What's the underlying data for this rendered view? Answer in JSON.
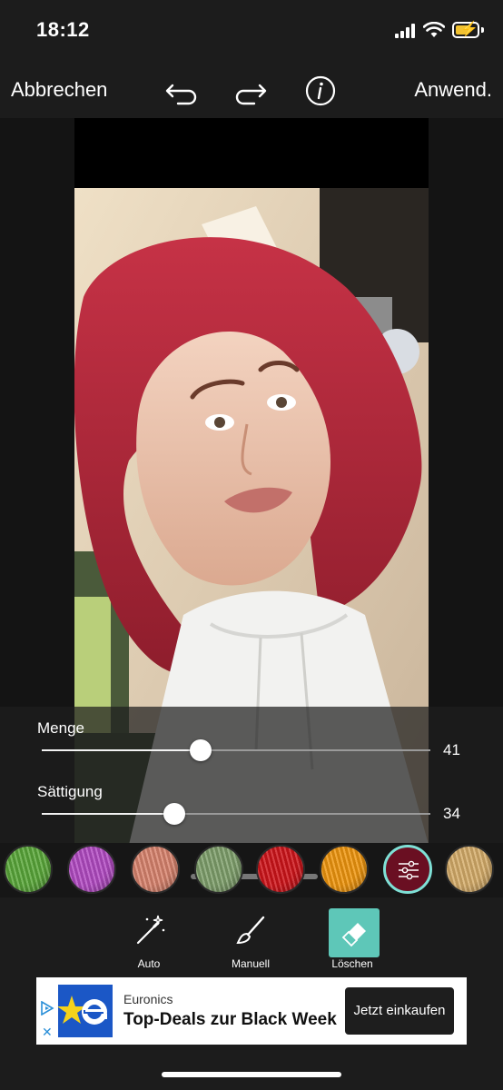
{
  "status_bar": {
    "time": "18:12"
  },
  "toolbar": {
    "cancel_label": "Abbrechen",
    "apply_label": "Anwend.",
    "icons": [
      "undo-icon",
      "redo-icon",
      "info-icon"
    ]
  },
  "sliders": {
    "amount": {
      "label": "Menge",
      "value": "41",
      "level": 0.41
    },
    "saturation": {
      "label": "Sättigung",
      "value": "34",
      "level": 0.34
    }
  },
  "colors": {
    "swatches": [
      {
        "name": "green",
        "color": "#5aa83a"
      },
      {
        "name": "purple",
        "color": "#b34bc4"
      },
      {
        "name": "peach",
        "color": "#d9846e"
      },
      {
        "name": "sage",
        "color": "#7fa06c"
      },
      {
        "name": "red",
        "color": "#d0141a"
      },
      {
        "name": "orange",
        "color": "#f0960e"
      },
      {
        "name": "custom",
        "color": "#6a0f22"
      },
      {
        "name": "blonde",
        "color": "#d6ad6a"
      }
    ],
    "selected_index": 6,
    "accent": "#7fe0d6"
  },
  "tools": {
    "auto_label": "Auto",
    "manual_label": "Manuell",
    "erase_label": "Löschen",
    "active": "erase"
  },
  "ad": {
    "brand": "Euronics",
    "headline": "Top-Deals zur Black Week",
    "cta": "Jetzt einkaufen"
  }
}
